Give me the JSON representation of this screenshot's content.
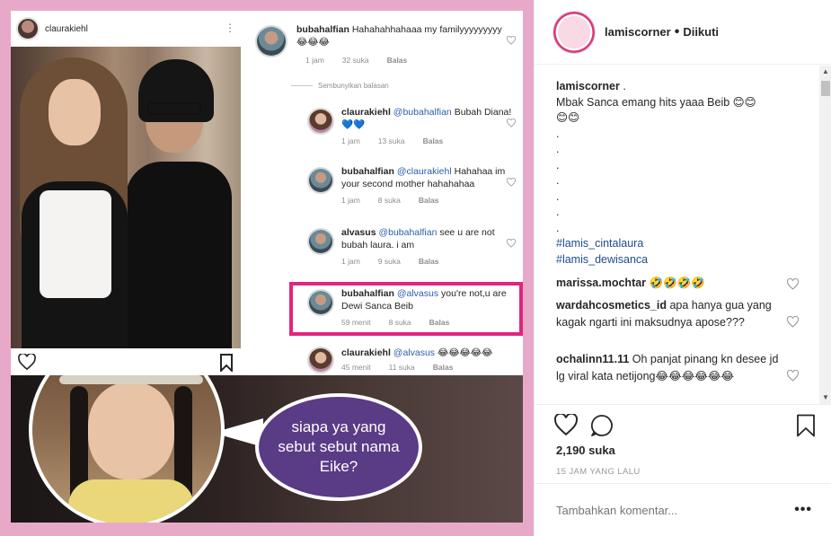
{
  "post": {
    "embedded_card": {
      "username": "claurakiehl"
    },
    "thread": [
      {
        "user": "bubahalfian",
        "text": "Hahahahhahaaa my familyyyyyyyyy 😂😂😂",
        "time": "1 jam",
        "likes": "32 suka",
        "reply": "Balas"
      },
      {
        "user": "claurakiehl",
        "mention": "@bubahalfian",
        "text": "Bubah Diana! 💙💙",
        "time": "1 jam",
        "likes": "13 suka",
        "reply": "Balas"
      },
      {
        "user": "bubahalfian",
        "mention": "@claurakiehl",
        "text": "Hahahaa im your second mother hahahahaa",
        "time": "1 jam",
        "likes": "8 suka",
        "reply": "Balas"
      },
      {
        "user": "alvasus",
        "mention": "@bubahalfian",
        "text": "see u are not bubah laura. i am",
        "time": "1 jam",
        "likes": "9 suka",
        "reply": "Balas"
      },
      {
        "user": "bubahalfian",
        "mention": "@alvasus",
        "text": "you're not,u are Dewi Sanca Beib",
        "time": "59 menit",
        "likes": "8 suka",
        "reply": "Balas"
      },
      {
        "user": "claurakiehl",
        "mention": "@alvasus",
        "text": "😂😂😂😂😂",
        "time": "45 menit",
        "likes": "11 suka",
        "reply": "Balas"
      }
    ],
    "hide_replies": "Sembunyikan balasan",
    "meme_bubble": "siapa ya yang sebut sebut nama Eike?",
    "accent_pink": "#e0257f",
    "frame_color": "#e8a9c9"
  },
  "header": {
    "username": "lamiscorner",
    "separator": "•",
    "follow_status": "Diikuti"
  },
  "caption": {
    "username": "lamiscorner",
    "first": ".",
    "lines": [
      "Mbak Sanca emang hits yaaa Beib 😊😊",
      "😊😊",
      ".",
      ".",
      ".",
      ".",
      ".",
      ".",
      "."
    ],
    "hashtags": [
      "#lamis_cintalaura",
      "#lamis_dewisanca"
    ]
  },
  "comments": [
    {
      "user": "marissa.mochtar",
      "text": "🤣🤣🤣🤣"
    },
    {
      "user": "wardahcosmetics_id",
      "text": "apa hanya gua yang kagak ngarti ini maksudnya apose???"
    },
    {
      "user": "ochalinn11.11",
      "text": "Oh panjat pinang kn desee jd lg viral kata netijong😂😂😂😂😂😂"
    }
  ],
  "likes": "2,190 suka",
  "time_ago": "15 JAM YANG LALU",
  "add_comment_placeholder": "Tambahkan komentar...",
  "more_label": "•••",
  "icons": {
    "like": "heart-icon",
    "comment": "comment-bubble-icon",
    "save": "bookmark-icon",
    "more": "more-options-icon"
  }
}
